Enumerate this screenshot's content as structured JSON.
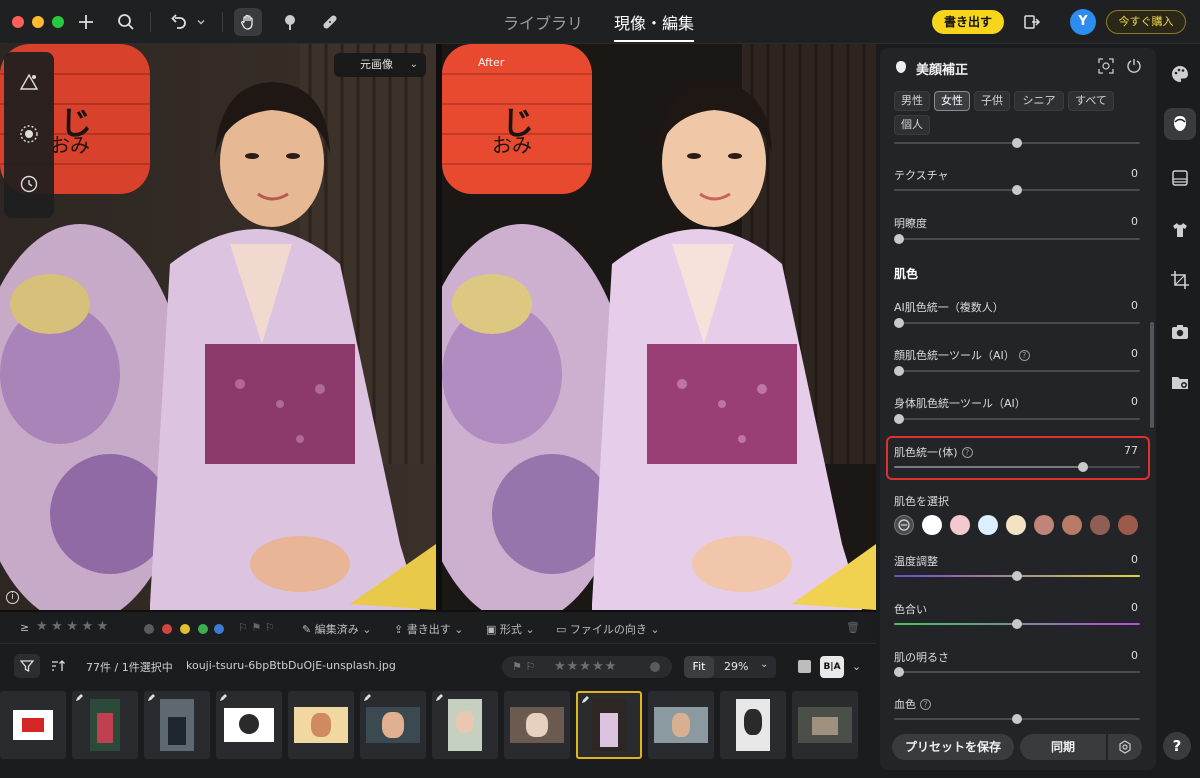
{
  "toolbar": {
    "tabs": [
      "ライブラリ",
      "現像・編集"
    ],
    "active_tab": "現像・編集",
    "export_label": "書き出す",
    "avatar_letter": "Y",
    "buy_label": "今すぐ購入"
  },
  "viewer": {
    "original_dropdown": "元画像",
    "after_label": "After"
  },
  "filterbar": {
    "gte": "≥",
    "edited": "編集済み",
    "export": "書き出す",
    "format": "形式",
    "orientation": "ファイルの向き"
  },
  "stripbar": {
    "count_text": "77件 / 1件選択中",
    "filename": "kouji-tsuru-6bpBtbDuOjE-unsplash.jpg",
    "fit_label": "Fit",
    "zoom_value": "29%"
  },
  "filmstrip": {
    "count": 12,
    "selected_index": 8
  },
  "panel": {
    "title": "美顔補正",
    "gender_options": [
      "男性",
      "女性",
      "子供",
      "シニア",
      "すべて",
      "個人"
    ],
    "gender_selected": "女性",
    "texture": {
      "label": "テクスチャ",
      "value": "0"
    },
    "clarity": {
      "label": "明瞭度",
      "value": "0"
    },
    "skin_section": "肌色",
    "ai_unify": {
      "label": "AI肌色統一（複数人）",
      "value": "0"
    },
    "face_tool": {
      "label": "顔肌色統一ツール（AI）",
      "value": "0"
    },
    "body_tool": {
      "label": "身体肌色統一ツール（AI）",
      "value": "0"
    },
    "body_unify": {
      "label": "肌色統一(体)",
      "value": "77",
      "level": 0.77
    },
    "select_skin": "肌色を選択",
    "temperature": {
      "label": "温度調整",
      "value": "0"
    },
    "tint": {
      "label": "色合い",
      "value": "0"
    },
    "brightness": {
      "label": "肌の明るさ",
      "value": "0"
    },
    "blood": {
      "label": "血色"
    },
    "swatches": [
      "#ffffff",
      "#f2c9cc",
      "#dcefff",
      "#f3e3c2",
      "#c08478",
      "#b97a66",
      "#8f5f55",
      "#9b5a4a"
    ],
    "preset_btn": "プリセットを保存",
    "sync_btn": "同期"
  },
  "colors": {
    "accent_yellow": "#f7d51b",
    "highlight_red": "#e03030",
    "avatar_blue": "#2d8cf0"
  }
}
